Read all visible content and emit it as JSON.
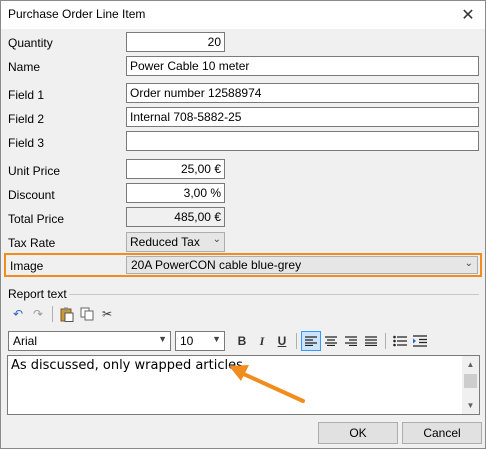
{
  "window": {
    "title": "Purchase Order Line Item"
  },
  "fields": {
    "quantity": {
      "label": "Quantity",
      "value": "20"
    },
    "name": {
      "label": "Name",
      "value": "Power Cable 10 meter"
    },
    "field1": {
      "label": "Field 1",
      "value": "Order number 12588974"
    },
    "field2": {
      "label": "Field 2",
      "value": "Internal 708-5882-25"
    },
    "field3": {
      "label": "Field 3",
      "value": ""
    },
    "unit_price": {
      "label": "Unit Price",
      "value": "25,00 €"
    },
    "discount": {
      "label": "Discount",
      "value": "3,00 %"
    },
    "total_price": {
      "label": "Total Price",
      "value": "485,00 €"
    },
    "tax_rate": {
      "label": "Tax Rate",
      "value": "Reduced Tax"
    },
    "image": {
      "label": "Image",
      "value": "20A PowerCON cable blue-grey"
    }
  },
  "report": {
    "label": "Report text",
    "font": "Arial",
    "size": "10",
    "bold": "B",
    "italic": "I",
    "underline": "U",
    "text": "As discussed, only wrapped articles."
  },
  "buttons": {
    "ok": "OK",
    "cancel": "Cancel"
  },
  "colors": {
    "highlight": "#f28c1d",
    "arrow": "#f28c1d"
  }
}
